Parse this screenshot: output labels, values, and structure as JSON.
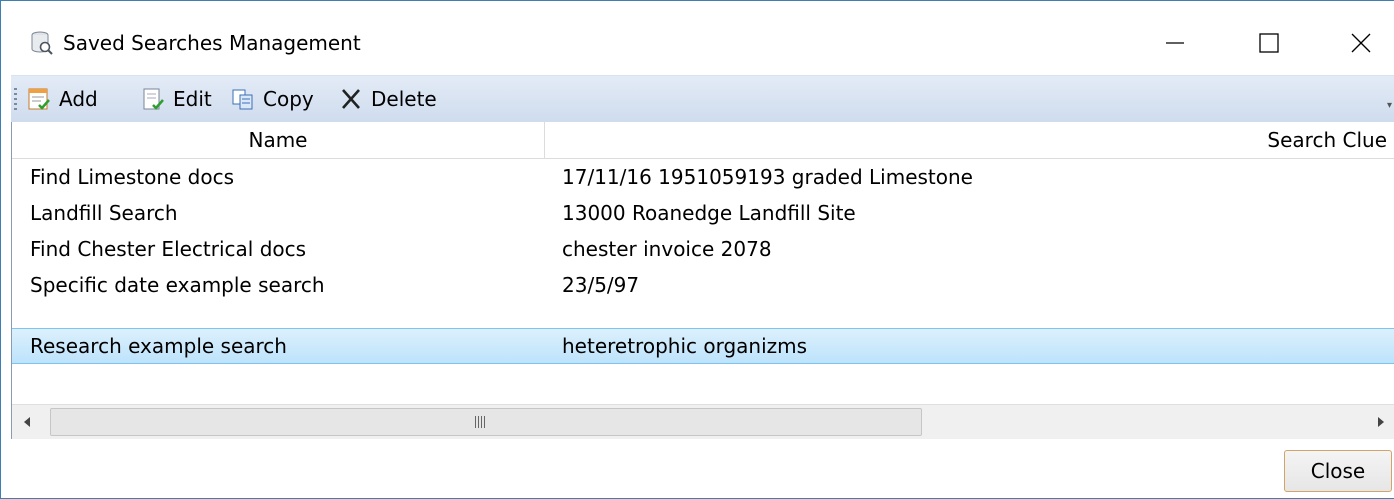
{
  "window": {
    "title": "Saved Searches Management",
    "icon": "database-search-icon"
  },
  "toolbar": {
    "add_label": "Add",
    "edit_label": "Edit",
    "copy_label": "Copy",
    "delete_label": "Delete"
  },
  "grid": {
    "columns": [
      "Name",
      "Search Clue"
    ],
    "rows": [
      {
        "name": "Find Limestone docs",
        "clue": "17/11/16 1951059193 graded Limestone"
      },
      {
        "name": "Landfill Search",
        "clue": "13000 Roanedge Landfill Site"
      },
      {
        "name": "Find Chester Electrical docs",
        "clue": "chester invoice 2078"
      },
      {
        "name": "Specific date example search",
        "clue": "23/5/97"
      },
      {
        "name": "Research example search",
        "clue": "heteretrophic organizms"
      }
    ],
    "selected_row": 4
  },
  "footer": {
    "close_label": "Close"
  },
  "colors": {
    "selection": "#bde3fb",
    "toolbar": "#d6e2f2",
    "window_border": "#3c7fb1"
  }
}
